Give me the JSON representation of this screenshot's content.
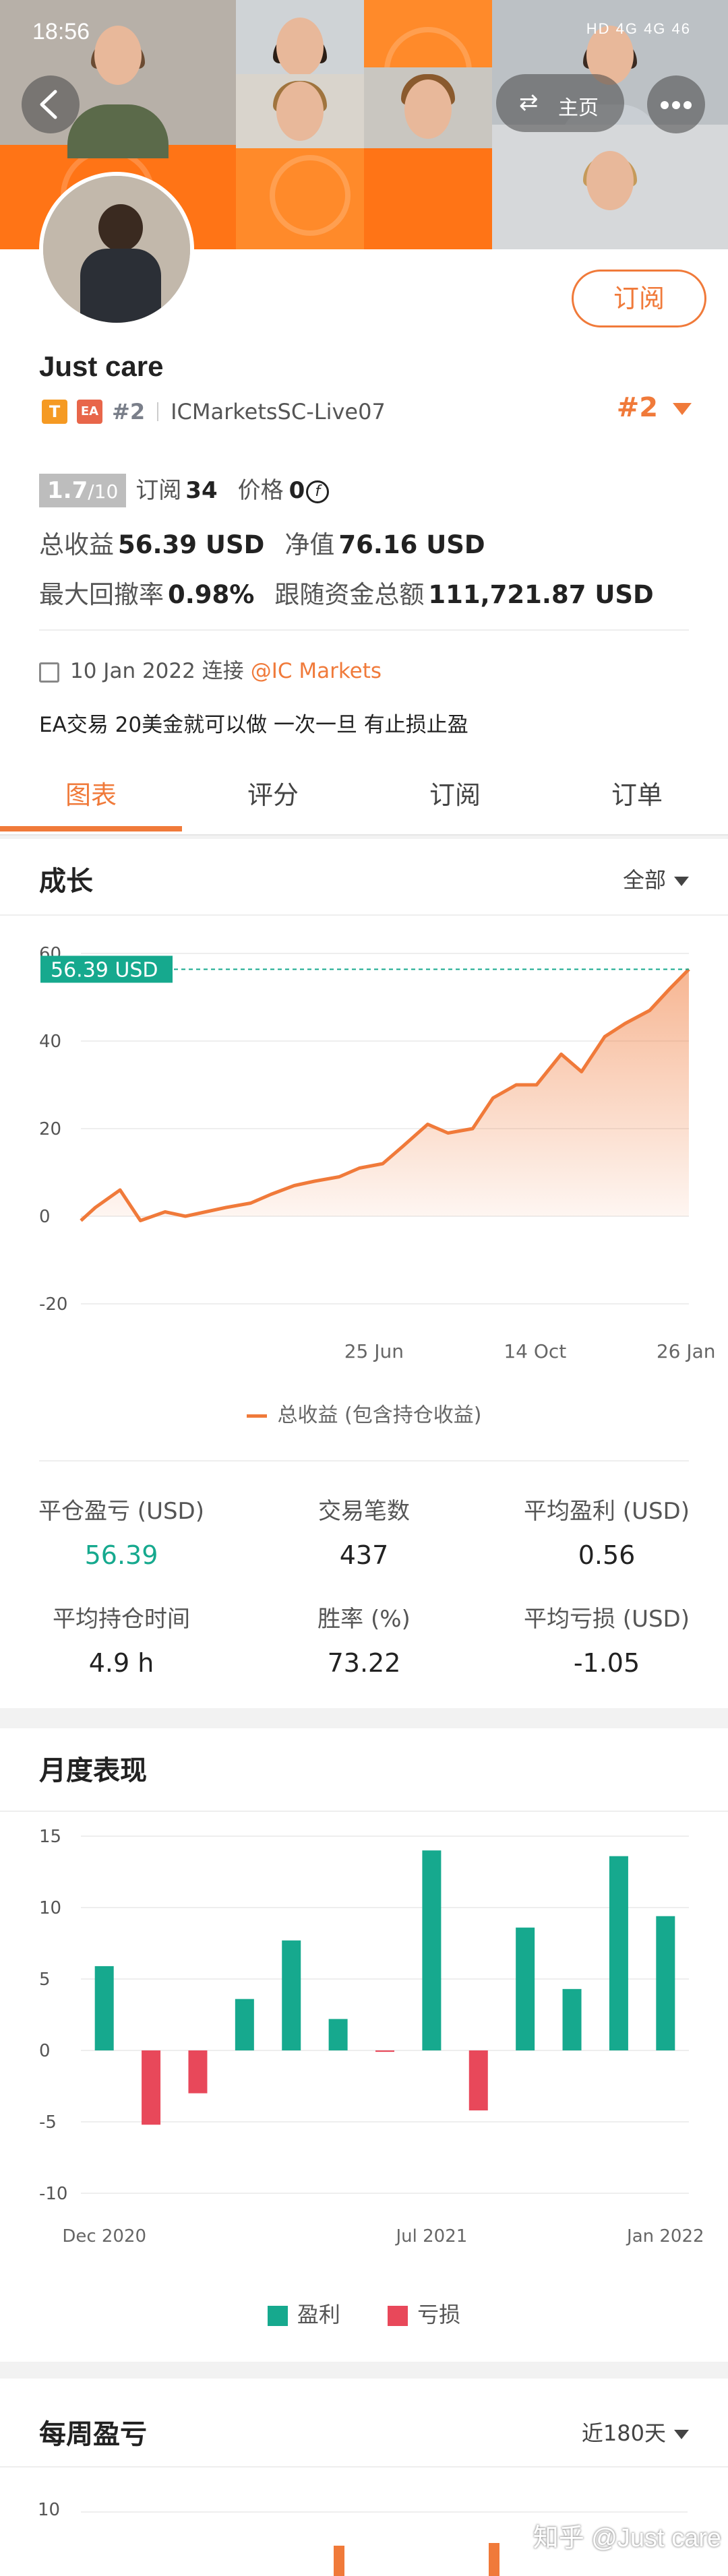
{
  "status_bar": {
    "time": "18:56",
    "indicators": "HD 4G 4G 46"
  },
  "header": {
    "home_label": "主页",
    "back_icon": "chevron-left-icon",
    "more_icon": "more-dots-icon"
  },
  "profile": {
    "name": "Just care",
    "subscribe_label": "订阅",
    "badge_t": "T",
    "badge_ea": "EA",
    "rank_small": "#2",
    "account": "ICMarketsSC-Live07",
    "rank_big": "#2",
    "score": "1.7",
    "score_max": "/10",
    "subscribers_label": "订阅",
    "subscribers": "34",
    "price_label": "价格",
    "price": "0",
    "total_profit_label": "总收益",
    "total_profit": "56.39 USD",
    "equity_label": "净值",
    "equity": "76.16 USD",
    "drawdown_label": "最大回撤率",
    "drawdown": "0.98%",
    "follow_funds_label": "跟随资金总额",
    "follow_funds": "111,721.87 USD",
    "connect_date": "10 Jan 2022 连接",
    "broker": "@IC Markets",
    "description": "EA交易 20美金就可以做 一次一旦 有止损止盈"
  },
  "tabs": [
    {
      "label": "图表",
      "active": true
    },
    {
      "label": "评分",
      "active": false
    },
    {
      "label": "订阅",
      "active": false
    },
    {
      "label": "订单",
      "active": false
    }
  ],
  "growth": {
    "title": "成长",
    "filter": "全部",
    "legend": "总收益 (包含持仓收益)",
    "current_label": "56.39 USD"
  },
  "metrics": [
    {
      "label": "平仓盈亏 (USD)",
      "value": "56.39",
      "green": true
    },
    {
      "label": "交易笔数",
      "value": "437",
      "green": false
    },
    {
      "label": "平均盈利 (USD)",
      "value": "0.56",
      "green": false
    },
    {
      "label": "平均持仓时间",
      "value": "4.9 h",
      "green": false
    },
    {
      "label": "胜率 (%)",
      "value": "73.22",
      "green": false
    },
    {
      "label": "平均亏损 (USD)",
      "value": "-1.05",
      "green": false
    }
  ],
  "monthly": {
    "title": "月度表现",
    "legend_profit": "盈利",
    "legend_loss": "亏损"
  },
  "weekly": {
    "title": "每周盈亏",
    "filter": "近180天",
    "ytick": "10"
  },
  "watermark": "知乎 @Just care",
  "colors": {
    "accent": "#f07a3a",
    "profit": "#16a98e",
    "loss": "#e8485a"
  },
  "chart_data": [
    {
      "type": "area",
      "title": "成长",
      "series": [
        {
          "name": "总收益 (包含持仓收益)",
          "color": "#f07a3a"
        }
      ],
      "x": [
        "2020-12-05",
        "2020-12-15",
        "2021-01-01",
        "2021-01-15",
        "2021-02-01",
        "2021-02-15",
        "2021-03-01",
        "2021-03-15",
        "2021-04-01",
        "2021-04-15",
        "2021-05-01",
        "2021-05-15",
        "2021-06-01",
        "2021-06-15",
        "2021-07-01",
        "2021-07-15",
        "2021-08-01",
        "2021-08-15",
        "2021-09-01",
        "2021-09-15",
        "2021-10-01",
        "2021-10-15",
        "2021-11-01",
        "2021-11-15",
        "2021-12-01",
        "2021-12-15",
        "2022-01-01",
        "2022-01-15",
        "2022-01-28"
      ],
      "y": [
        -1,
        2,
        6,
        -1,
        1,
        0,
        1,
        2,
        3,
        5,
        7,
        8,
        9,
        11,
        12,
        16,
        21,
        19,
        20,
        27,
        30,
        30,
        37,
        33,
        41,
        44,
        47,
        52,
        56.39
      ],
      "xticks": [
        "25 Jun",
        "14 Oct",
        "26 Jan"
      ],
      "yticks": [
        -20,
        0,
        20,
        40,
        60
      ],
      "ylim": [
        -20,
        60
      ],
      "current_value": "56.39 USD"
    },
    {
      "type": "bar",
      "title": "月度表现",
      "categories": [
        "Dec 2020",
        "Jan 2021",
        "Feb 2021",
        "Mar 2021",
        "Apr 2021",
        "May 2021",
        "Jun 2021",
        "Jul 2021",
        "Aug 2021",
        "Sep 2021",
        "Oct 2021",
        "Nov 2021",
        "Dec 2021",
        "Jan 2022"
      ],
      "values": [
        5.9,
        -5.2,
        -3.0,
        3.6,
        7.7,
        2.2,
        -0.1,
        14.0,
        -4.2,
        8.6,
        4.3,
        13.6,
        9.4
      ],
      "xticks": [
        "Dec 2020",
        "Jul 2021",
        "Jan 2022"
      ],
      "yticks": [
        -10,
        -5,
        0,
        5,
        10,
        15
      ],
      "ylim": [
        -10,
        15
      ],
      "legend": [
        "盈利",
        "亏损"
      ]
    }
  ]
}
